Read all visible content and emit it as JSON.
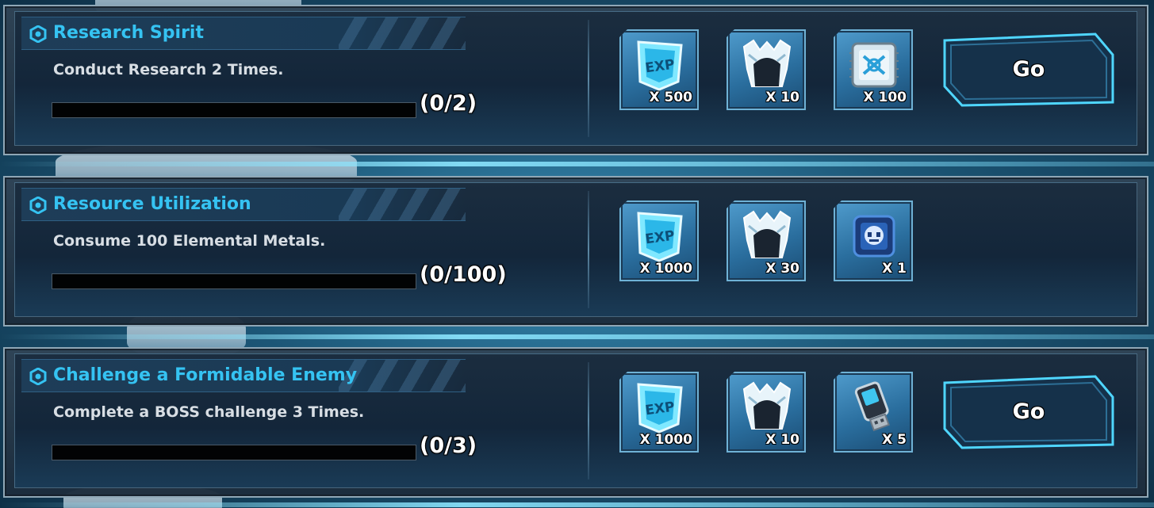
{
  "quests": [
    {
      "title": "Research Spirit",
      "description": "Conduct Research 2 Times.",
      "progress_text": "(0/2)",
      "progress_fraction": 0,
      "has_go": true,
      "go_label": "Go",
      "rewards": [
        {
          "icon": "exp-chip-icon",
          "qty": "X 500"
        },
        {
          "icon": "helmet-armor-icon",
          "qty": "X 10"
        },
        {
          "icon": "circuit-chip-icon",
          "qty": "X 100"
        }
      ]
    },
    {
      "title": "Resource Utilization",
      "description": "Consume 100 Elemental Metals.",
      "progress_text": "(0/100)",
      "progress_fraction": 0,
      "has_go": false,
      "go_label": "",
      "rewards": [
        {
          "icon": "exp-chip-icon",
          "qty": "X 1000"
        },
        {
          "icon": "helmet-armor-icon",
          "qty": "X 30"
        },
        {
          "icon": "robot-face-cube-icon",
          "qty": "X 1"
        }
      ]
    },
    {
      "title": "Challenge a Formidable Enemy",
      "description": "Complete a BOSS challenge 3 Times.",
      "progress_text": "(0/3)",
      "progress_fraction": 0,
      "has_go": true,
      "go_label": "Go",
      "rewards": [
        {
          "icon": "exp-chip-icon",
          "qty": "X 1000"
        },
        {
          "icon": "helmet-armor-icon",
          "qty": "X 10"
        },
        {
          "icon": "usb-drive-icon",
          "qty": "X 5"
        }
      ]
    }
  ],
  "colors": {
    "title": "#35c3f2",
    "accent": "#4fd6ff"
  }
}
